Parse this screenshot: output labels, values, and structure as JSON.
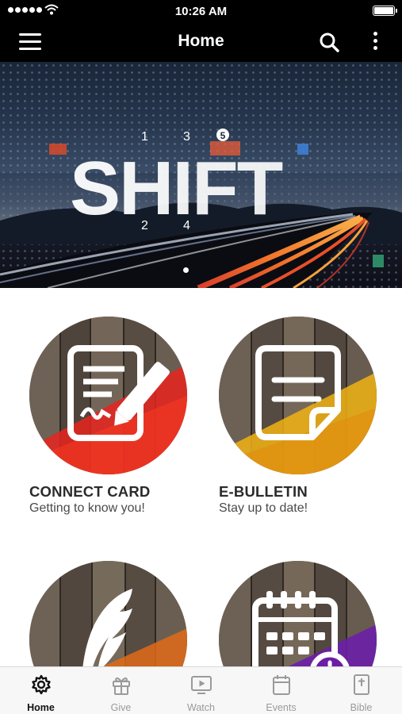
{
  "status_bar": {
    "time": "10:26 AM"
  },
  "nav": {
    "title": "Home"
  },
  "banner": {
    "title_letters": "SHIFT",
    "numbers": [
      "1",
      "2",
      "3",
      "4",
      "5"
    ],
    "page_count": 3,
    "active_page": 1
  },
  "tiles": [
    {
      "title": "CONNECT CARD",
      "subtitle": "Getting to know you!",
      "accent": "#e8251f",
      "icon": "connect-card-icon"
    },
    {
      "title": "E-BULLETIN",
      "subtitle": "Stay up to date!",
      "accent": "#f1b313",
      "icon": "bulletin-icon"
    },
    {
      "title": "",
      "subtitle": "",
      "accent": "#e06a17",
      "icon": "feather-icon"
    },
    {
      "title": "",
      "subtitle": "",
      "accent": "#6b1fa6",
      "icon": "calendar-icon"
    }
  ],
  "tab_bar": {
    "active": "Home",
    "tabs": [
      {
        "label": "Home",
        "icon": "gear-icon"
      },
      {
        "label": "Give",
        "icon": "gift-icon"
      },
      {
        "label": "Watch",
        "icon": "tv-play-icon"
      },
      {
        "label": "Events",
        "icon": "calendar-icon"
      },
      {
        "label": "Bible",
        "icon": "bible-icon"
      }
    ]
  },
  "colors": {
    "bar_bg": "#000000",
    "tab_active": "#111111",
    "tab_inactive": "#9a9a9a"
  }
}
